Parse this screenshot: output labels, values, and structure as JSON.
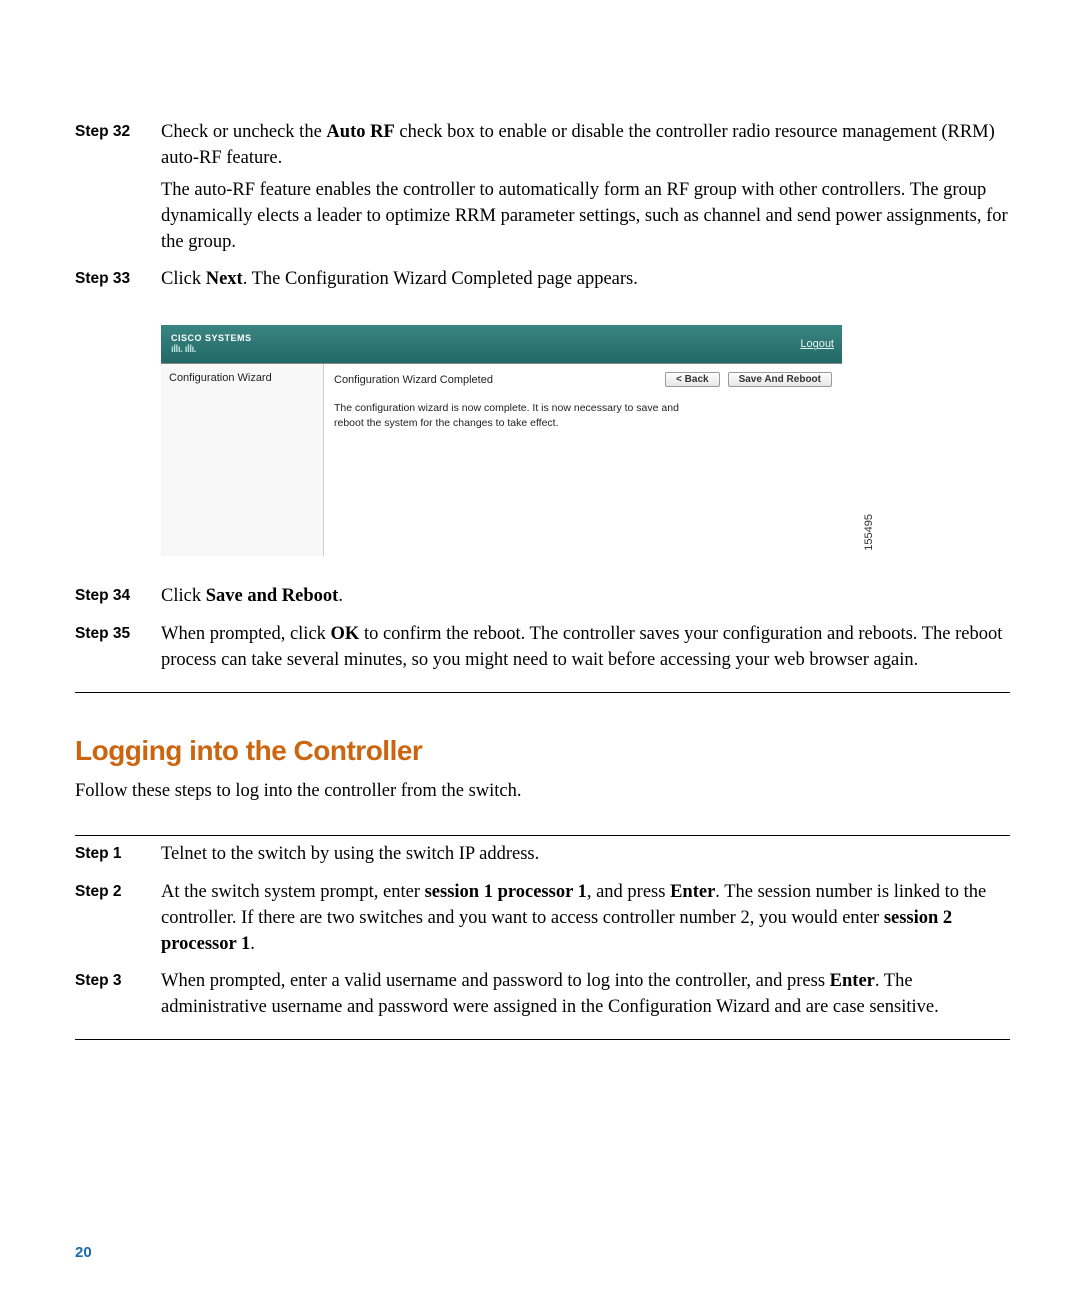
{
  "steps_top": [
    {
      "label": "Step 32",
      "paras": [
        [
          {
            "t": "Check or uncheck the "
          },
          {
            "t": "Auto RF",
            "b": true
          },
          {
            "t": " check box to enable or disable the controller radio resource management (RRM) auto-RF feature."
          }
        ],
        [
          {
            "t": "The auto-RF feature enables the controller to automatically form an RF group with other controllers. The group dynamically elects a leader to optimize RRM parameter settings, such as channel and send power assignments, for the group."
          }
        ]
      ]
    },
    {
      "label": "Step 33",
      "paras": [
        [
          {
            "t": "Click "
          },
          {
            "t": "Next",
            "b": true
          },
          {
            "t": ". The Configuration Wizard Completed page appears."
          }
        ]
      ]
    }
  ],
  "screenshot": {
    "logo_top": "CISCO SYSTEMS",
    "logout": "Logout",
    "left_title": "Configuration Wizard",
    "right_title": "Configuration Wizard Completed",
    "back_btn": "< Back",
    "save_btn": "Save And Reboot",
    "desc": "The configuration wizard is now complete. It is now necessary to save and reboot the system for the changes to take effect.",
    "idnum": "155495"
  },
  "steps_after_screenshot": [
    {
      "label": "Step 34",
      "paras": [
        [
          {
            "t": "Click "
          },
          {
            "t": "Save and Reboot",
            "b": true
          },
          {
            "t": "."
          }
        ]
      ]
    },
    {
      "label": "Step 35",
      "paras": [
        [
          {
            "t": "When prompted, click "
          },
          {
            "t": "OK",
            "b": true
          },
          {
            "t": " to confirm the reboot. The controller saves your configuration and reboots. The reboot process can take several minutes, so you might need to wait before accessing your web browser again."
          }
        ]
      ]
    }
  ],
  "section_heading": "Logging into the Controller",
  "section_intro": "Follow these steps to log into the controller from the switch.",
  "steps_bottom": [
    {
      "label": "Step 1",
      "paras": [
        [
          {
            "t": "Telnet to the switch by using the switch IP address."
          }
        ]
      ]
    },
    {
      "label": "Step 2",
      "paras": [
        [
          {
            "t": "At the switch system prompt, enter "
          },
          {
            "t": "session 1 processor 1",
            "b": true
          },
          {
            "t": ", and press "
          },
          {
            "t": "Enter",
            "b": true
          },
          {
            "t": ". The session number is linked to the controller. If there are two switches and you want to access controller number 2, you would enter "
          },
          {
            "t": "session 2 processor 1",
            "b": true
          },
          {
            "t": "."
          }
        ]
      ]
    },
    {
      "label": "Step 3",
      "paras": [
        [
          {
            "t": "When prompted, enter a valid username and password to log into the controller, and press "
          },
          {
            "t": "Enter",
            "b": true
          },
          {
            "t": ". The administrative username and password were assigned in the Configuration Wizard and are case sensitive."
          }
        ]
      ]
    }
  ],
  "page_number": "20"
}
